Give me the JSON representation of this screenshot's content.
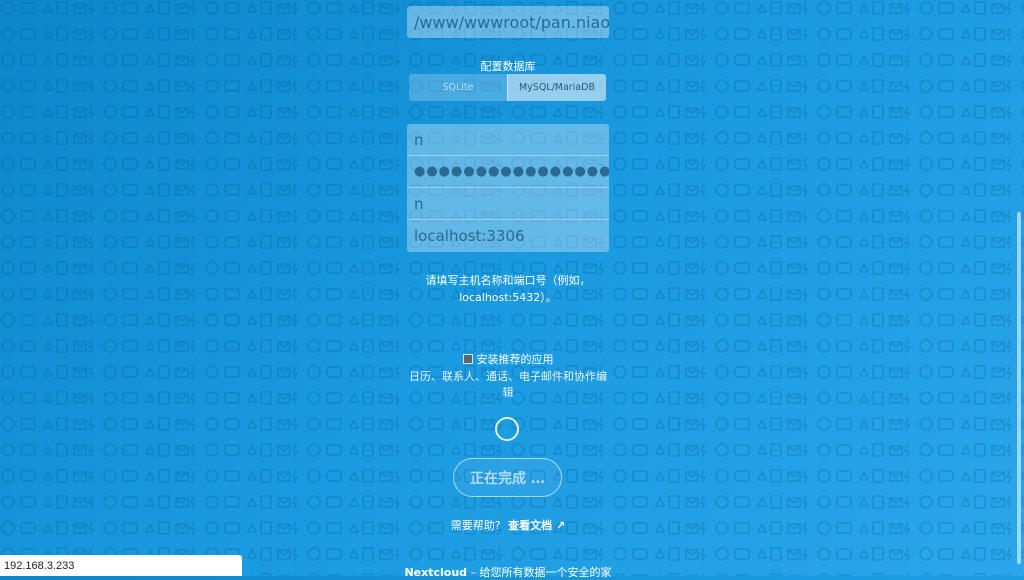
{
  "setup": {
    "data_dir_value": "/www/wwwroot/pan.niaodl",
    "db_section_label": "配置数据库",
    "db_options": [
      "SQLite",
      "MySQL/MariaDB"
    ],
    "db_user_value": "n",
    "db_password_value": "●●●●●●●●●●●●●●●●",
    "db_name_value": "n",
    "db_host_value": "localhost:3306",
    "host_hint": "请填写主机名称和端口号（例如，localhost:5432）。",
    "install_apps_label": "安装推荐的应用",
    "install_apps_desc": "日历、联系人、通话、电子邮件和协作编辑",
    "finish_button_label": "正在完成 …",
    "help_prefix": "需要帮助?",
    "help_link": "查看文档 ↗",
    "footer_brand": "Nextcloud",
    "footer_tagline": " – 给您所有数据一个安全的家"
  },
  "status_bar": {
    "url": "192.168.3.233"
  },
  "icons": {
    "eye": "eye-icon",
    "spinner": "loading-spinner-icon",
    "checkbox": "checkbox-icon"
  },
  "colors": {
    "background": "#1a9ae0",
    "field_text": "#2a6a93"
  }
}
